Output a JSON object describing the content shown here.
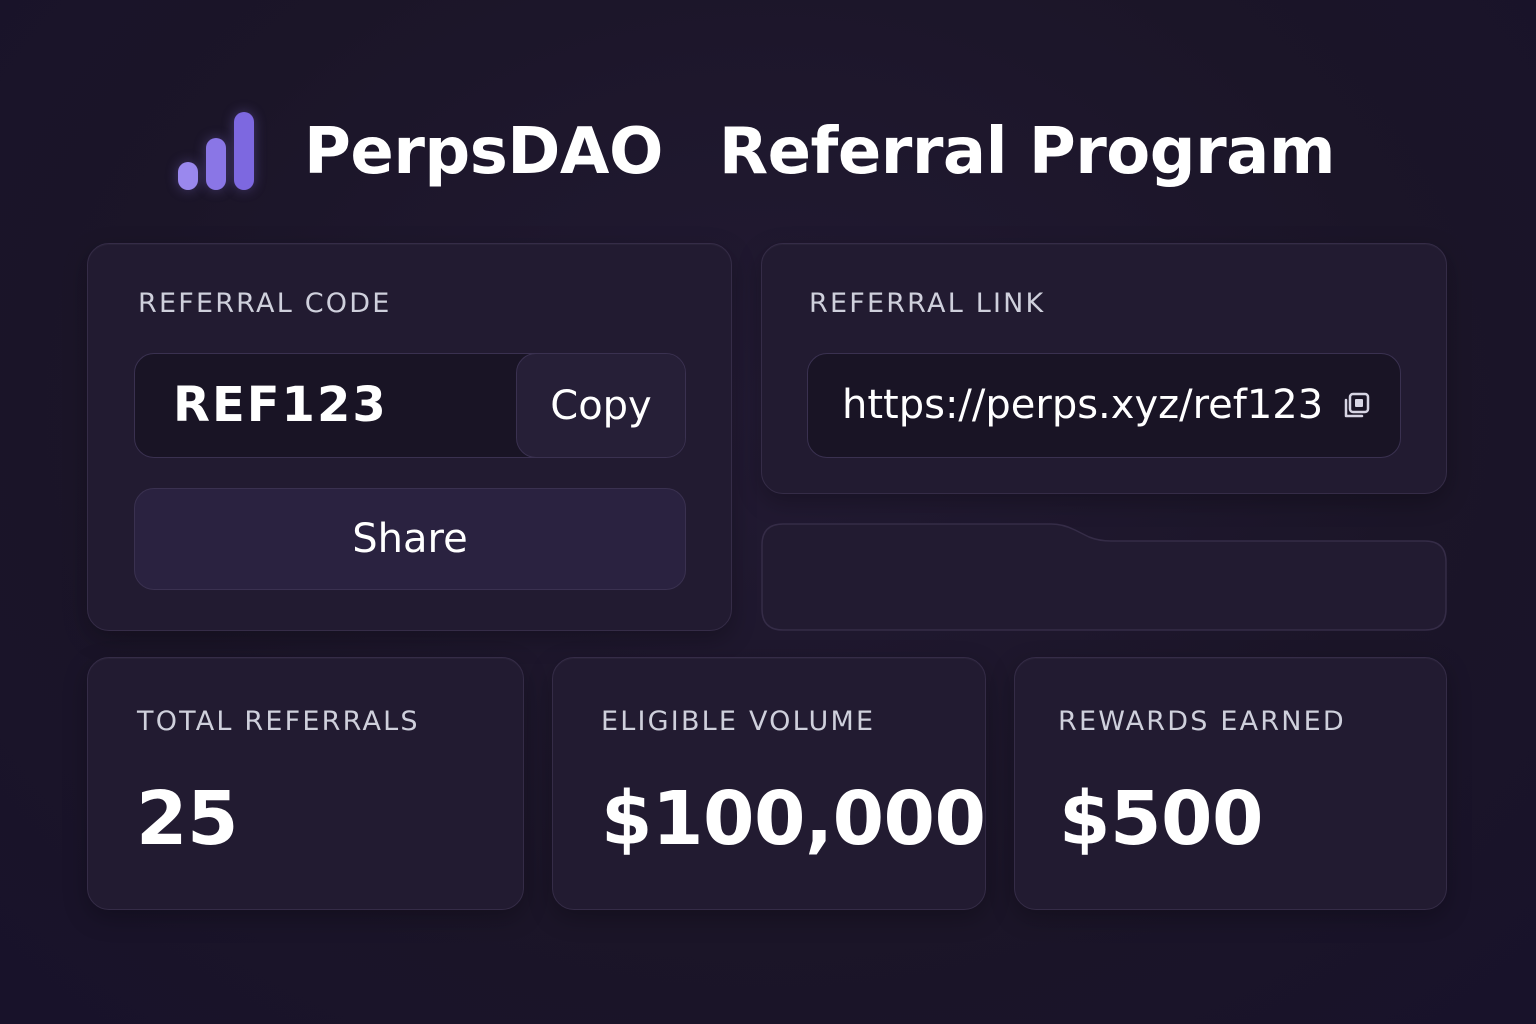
{
  "header": {
    "brand": "PerpsDAO",
    "title": "Referral Program",
    "logo_icon": "bar-chart-icon",
    "accent_color": "#8f7ce8"
  },
  "referral_code": {
    "label": "REFERRAL CODE",
    "value": "REF123",
    "copy_label": "Copy",
    "share_label": "Share"
  },
  "referral_link": {
    "label": "REFERRAL LINK",
    "value": "https://perps.xyz/ref123",
    "copy_icon": "copy-icon"
  },
  "stats": [
    {
      "label": "TOTAL REFERRALS",
      "value": "25"
    },
    {
      "label": "ELIGIBLE VOLUME",
      "value": "$100,000"
    },
    {
      "label": "REWARDS EARNED",
      "value": "$500"
    }
  ]
}
